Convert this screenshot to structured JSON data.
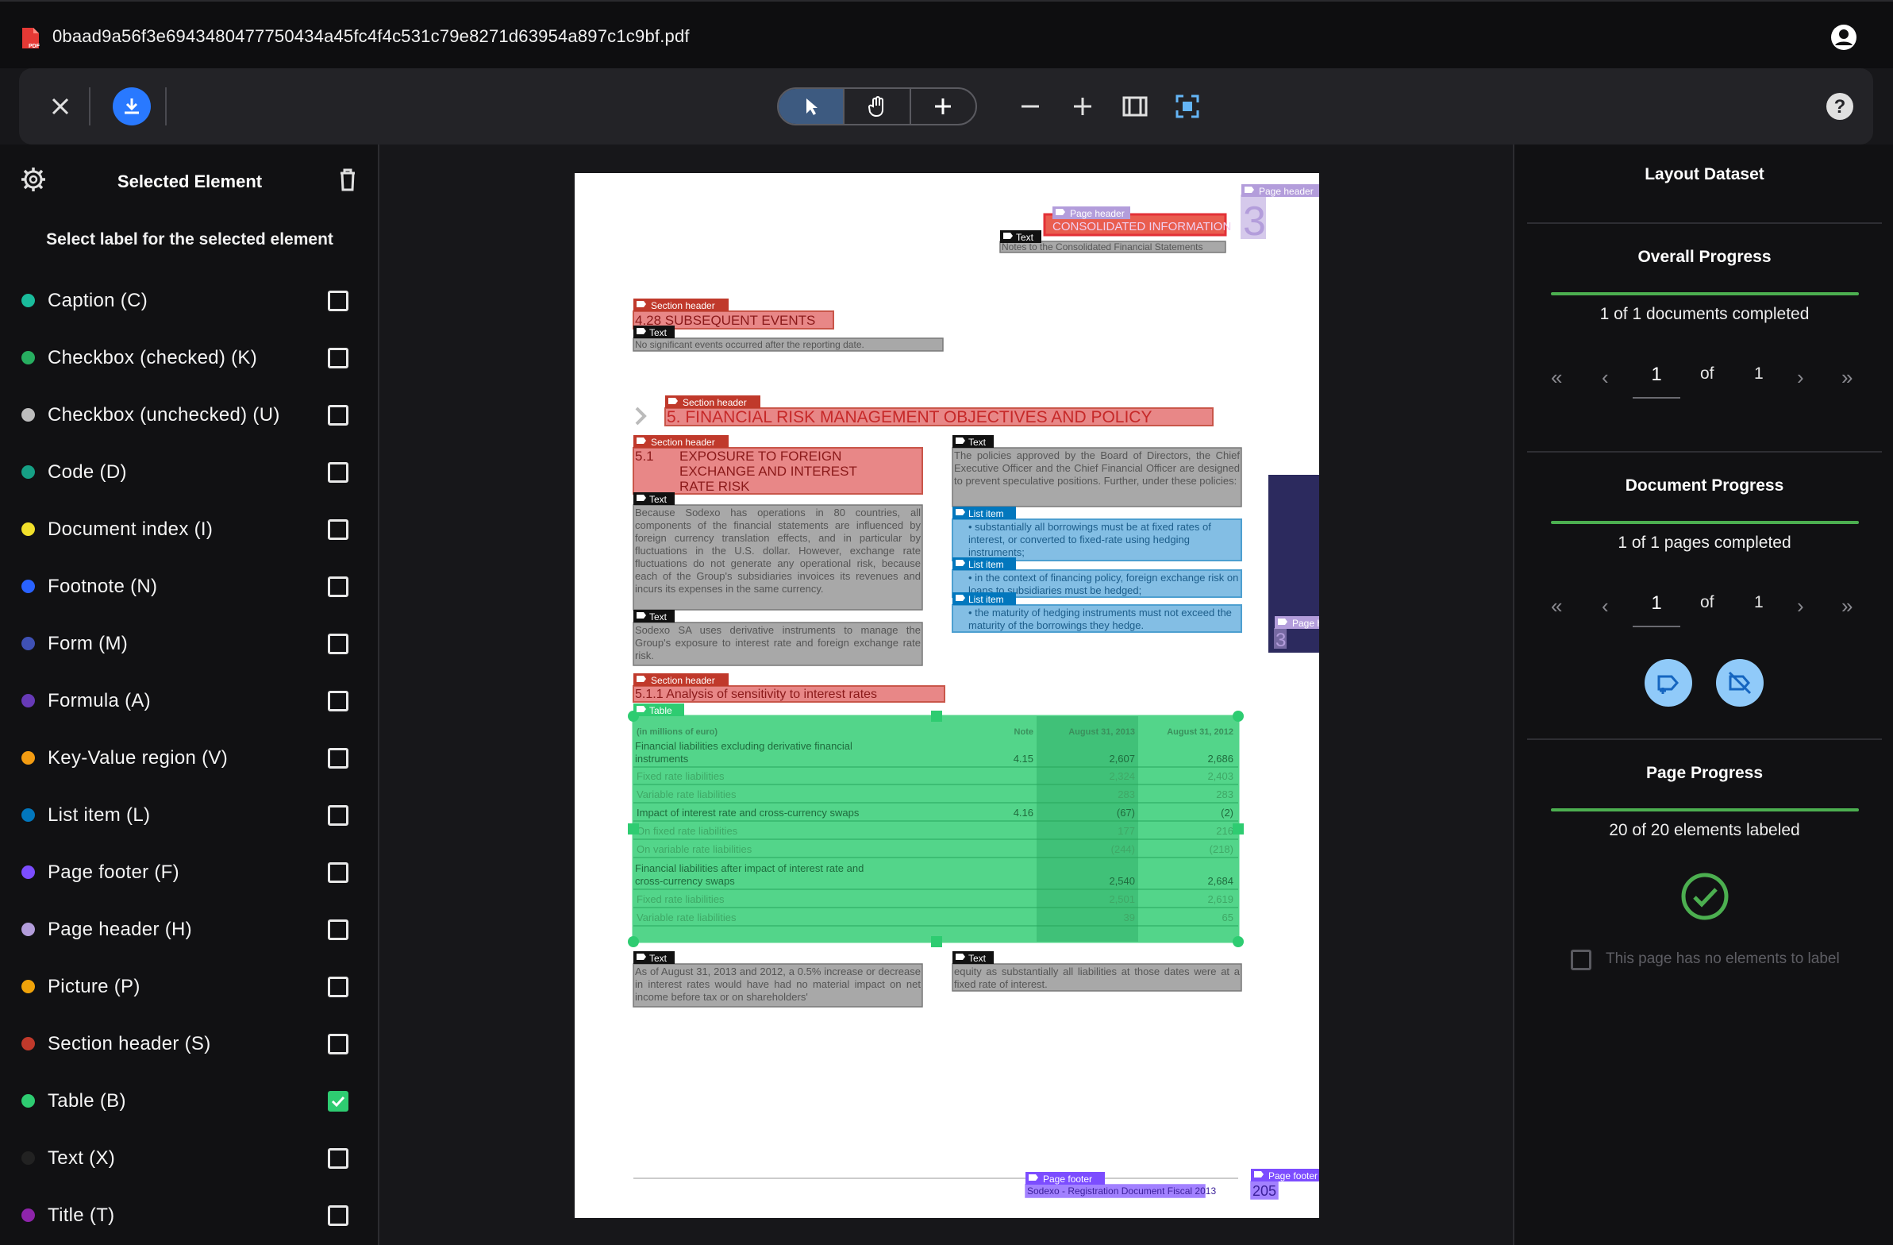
{
  "app": {
    "filename": "0baad9a56f3e6943480477750434a45fc4f4c531c79e8271d63954a897c1c9bf.pdf",
    "icons": {
      "pdf": "pdf-file-icon",
      "account": "account-circle-icon"
    }
  },
  "toolbar": {
    "close": "close-icon",
    "download": "download-icon",
    "modes": [
      "select-pointer-icon",
      "pan-hand-icon",
      "add-plus-icon"
    ],
    "active_mode": "select-pointer-icon",
    "zoom_out": "minus-icon",
    "zoom_in": "plus-icon",
    "fit_width": "fit-width-icon",
    "fit_page": "fit-page-icon",
    "help": "help-icon",
    "accent": "#2979ff"
  },
  "left_panel": {
    "title": "Selected Element",
    "subtitle": "Select label for the selected element",
    "labels": [
      {
        "text": "Caption (C)",
        "color": "#1abc9c",
        "checked": false
      },
      {
        "text": "Checkbox (checked) (K)",
        "color": "#27ae60",
        "checked": false
      },
      {
        "text": "Checkbox (unchecked) (U)",
        "color": "#bdbdbd",
        "checked": false
      },
      {
        "text": "Code (D)",
        "color": "#16a085",
        "checked": false
      },
      {
        "text": "Document index (I)",
        "color": "#f1e02b",
        "checked": false
      },
      {
        "text": "Footnote (N)",
        "color": "#2962ff",
        "checked": false
      },
      {
        "text": "Form (M)",
        "color": "#3f51b5",
        "checked": false
      },
      {
        "text": "Formula (A)",
        "color": "#673ab7",
        "checked": false
      },
      {
        "text": "Key-Value region (V)",
        "color": "#f39c12",
        "checked": false
      },
      {
        "text": "List item (L)",
        "color": "#0277bd",
        "checked": false
      },
      {
        "text": "Page footer (F)",
        "color": "#7c4dff",
        "checked": false
      },
      {
        "text": "Page header (H)",
        "color": "#b39ddb",
        "checked": false
      },
      {
        "text": "Picture (P)",
        "color": "#f0a30a",
        "checked": false
      },
      {
        "text": "Section header (S)",
        "color": "#c0392b",
        "checked": false
      },
      {
        "text": "Table (B)",
        "color": "#2ecc71",
        "checked": true
      },
      {
        "text": "Text (X)",
        "color": "#222222",
        "checked": false
      },
      {
        "text": "Title (T)",
        "color": "#8e24aa",
        "checked": false
      }
    ]
  },
  "document": {
    "tags": {
      "page_header": "Page header",
      "text": "Text",
      "section_header": "Section header",
      "list_item": "List item",
      "table": "Table",
      "page_footer": "Page footer"
    },
    "header_title": "CONSOLIDATED INFORMATION",
    "header_subtitle": "Notes to the Consolidated Financial Statements",
    "header_page_num": "3",
    "side_tab_num": "3",
    "sec_428": "4.28   SUBSEQUENT EVENTS",
    "sec_428_text": "No significant events occurred after the reporting date.",
    "sec_5": "5.   FINANCIAL RISK MANAGEMENT OBJECTIVES AND POLICY",
    "sec_51_num": "5.1",
    "sec_51_lines": [
      "EXPOSURE TO FOREIGN",
      "EXCHANGE AND INTEREST",
      "RATE RISK"
    ],
    "para_left1": "Because Sodexo has operations in 80 countries, all components of the financial statements are influenced by foreign currency translation effects, and in particular by fluctuations in the U.S. dollar. However, exchange rate fluctuations do not generate any operational risk, because each of the Group's subsidiaries invoices its revenues and incurs its expenses in the same currency.",
    "para_left2": "Sodexo SA uses derivative instruments to manage the Group's exposure to interest rate and foreign exchange rate risk.",
    "para_right1": "The policies approved by the Board of Directors, the Chief Executive Officer and the Chief Financial Officer are designed to prevent speculative positions. Further, under these policies:",
    "list1": "substantially all borrowings must be at fixed rates of interest, or converted to fixed-rate using hedging instruments;",
    "list2": "in the context of financing policy, foreign exchange risk on loans to subsidiaries must be hedged;",
    "list3": "the maturity of hedging instruments must not exceed the maturity of the borrowings they hedge.",
    "sec_511": "5.1.1   Analysis of sensitivity to interest rates",
    "table": {
      "headers": [
        "(in millions of euro)",
        "Note",
        "August 31, 2013",
        "August 31, 2012"
      ],
      "rows": [
        [
          "Financial liabilities excluding derivative financial instruments",
          "4.15",
          "2,607",
          "2,686"
        ],
        [
          "Fixed rate liabilities",
          "",
          "2,324",
          "2,403"
        ],
        [
          "Variable rate liabilities",
          "",
          "283",
          "283"
        ],
        [
          "Impact of interest rate and cross-currency swaps",
          "4.16",
          "(67)",
          "(2)"
        ],
        [
          "On fixed rate liabilities",
          "",
          "177",
          "216"
        ],
        [
          "On variable rate liabilities",
          "",
          "(244)",
          "(218)"
        ],
        [
          "Financial liabilities after impact of interest rate and cross-currency swaps",
          "",
          "2,540",
          "2,684"
        ],
        [
          "Fixed rate liabilities",
          "",
          "2,501",
          "2,619"
        ],
        [
          "Variable rate liabilities",
          "",
          "39",
          "65"
        ]
      ]
    },
    "bottom_left": "As of August 31, 2013 and 2012, a 0.5% increase or decrease in interest rates would have had no material impact on net income before tax or on shareholders'",
    "bottom_right": "equity as substantially all liabilities at those dates were at a fixed rate of interest.",
    "footer_text": "Sodexo - Registration Document Fiscal 2013",
    "footer_num": "205"
  },
  "right_panel": {
    "title": "Layout Dataset",
    "overall": {
      "title": "Overall Progress",
      "text": "1 of 1 documents completed",
      "current": "1",
      "of": "of",
      "total": "1",
      "progress": 1.0
    },
    "document": {
      "title": "Document Progress",
      "text": "1 of 1 pages completed",
      "current": "1",
      "of": "of",
      "total": "1",
      "progress": 1.0
    },
    "page": {
      "title": "Page Progress",
      "text": "20 of 20 elements labeled",
      "progress": 1.0
    },
    "no_elements_label": "This page has no elements to label",
    "colors": {
      "progress": "#4caf50",
      "round_button": "#90caf9"
    }
  }
}
